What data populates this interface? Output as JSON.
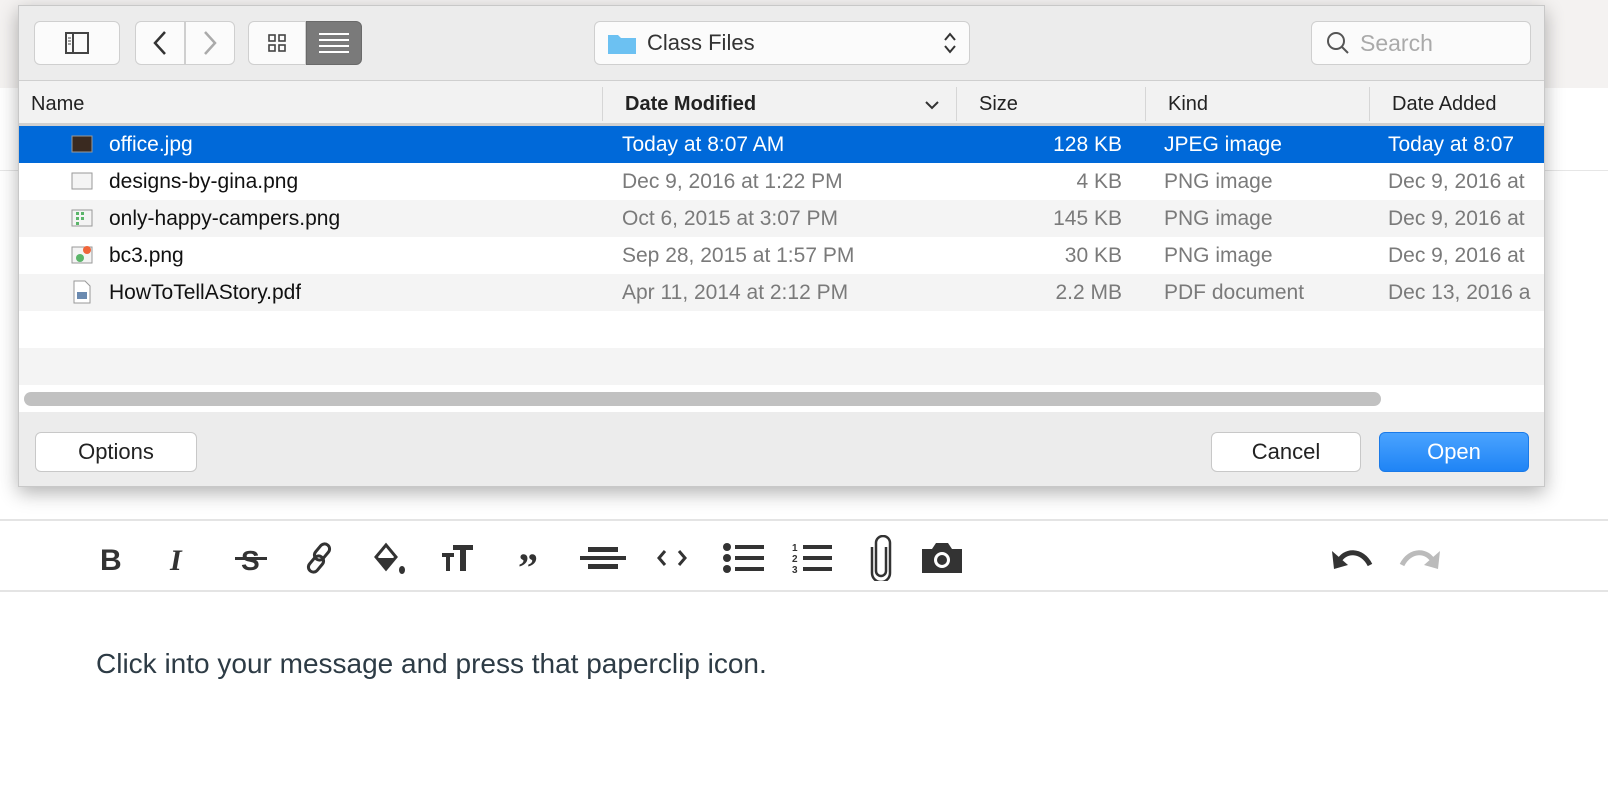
{
  "dialog": {
    "location": "Class Files",
    "search_placeholder": "Search",
    "columns": [
      "Name",
      "Date Modified",
      "Size",
      "Kind",
      "Date Added"
    ],
    "files": [
      {
        "name": "office.jpg",
        "modified": "Today at 8:07 AM",
        "size": "128 KB",
        "kind": "JPEG image",
        "added": "Today at 8:07",
        "icon": "image-thumbnail-icon",
        "selected": true
      },
      {
        "name": "designs-by-gina.png",
        "modified": "Dec 9, 2016 at 1:22 PM",
        "size": "4 KB",
        "kind": "PNG image",
        "added": "Dec 9, 2016 at",
        "icon": "image-thumbnail-icon"
      },
      {
        "name": "only-happy-campers.png",
        "modified": "Oct 6, 2015 at 3:07 PM",
        "size": "145 KB",
        "kind": "PNG image",
        "added": "Dec 9, 2016 at",
        "icon": "image-thumbnail-icon"
      },
      {
        "name": "bc3.png",
        "modified": "Sep 28, 2015 at 1:57 PM",
        "size": "30 KB",
        "kind": "PNG image",
        "added": "Dec 9, 2016 at",
        "icon": "image-thumbnail-icon"
      },
      {
        "name": "HowToTellAStory.pdf",
        "modified": "Apr 11, 2014 at 2:12 PM",
        "size": "2.2 MB",
        "kind": "PDF document",
        "added": "Dec 13, 2016 a",
        "icon": "pdf-document-icon"
      }
    ],
    "options_label": "Options",
    "cancel_label": "Cancel",
    "open_label": "Open",
    "accent": "#0069d9"
  },
  "editor": {
    "message": "Click into your message and press that paperclip icon."
  }
}
